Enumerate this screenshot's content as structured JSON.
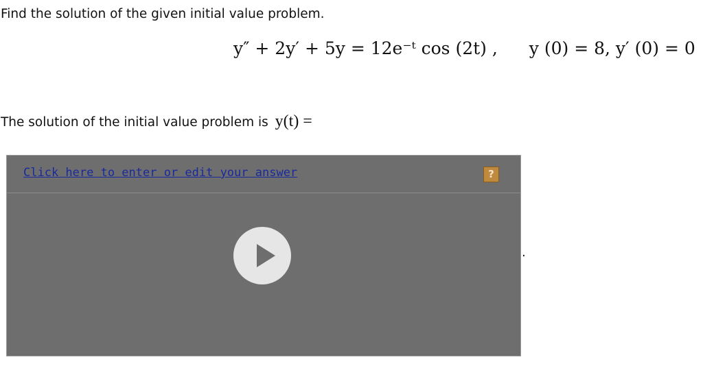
{
  "prompt": "Find the solution of the given initial value problem.",
  "equation": {
    "ode": "y″ + 2y′ + 5y = 12e⁻ᵗ cos (2t) ,",
    "initial_conditions": "y (0) = 8,   y′ (0) = 0"
  },
  "answer_prompt": {
    "text": "The solution of the initial value problem is",
    "math": "y(t) ="
  },
  "answer_box": {
    "link_label": "Click here to enter or edit your answer",
    "help_label": "?"
  },
  "trailing_period": "."
}
